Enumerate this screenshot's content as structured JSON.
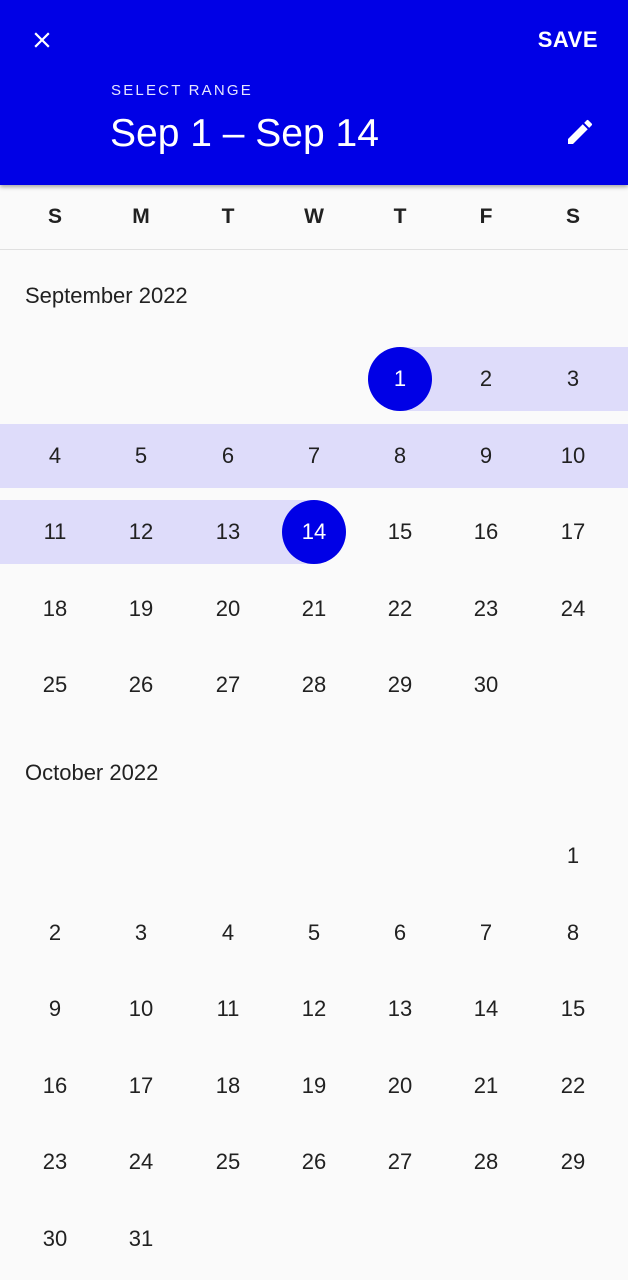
{
  "header": {
    "save_label": "SAVE",
    "select_range_label": "SELECT RANGE",
    "range_title": "Sep 1 – Sep 14",
    "accent_color": "#0000e6",
    "close_icon": "close-icon",
    "edit_icon": "pencil-icon"
  },
  "weekdays": [
    "S",
    "M",
    "T",
    "W",
    "T",
    "F",
    "S"
  ],
  "months": [
    {
      "label": "September 2022",
      "rows": [
        [
          "",
          "",
          "",
          "",
          "1",
          "2",
          "3"
        ],
        [
          "4",
          "5",
          "6",
          "7",
          "8",
          "9",
          "10"
        ],
        [
          "11",
          "12",
          "13",
          "14",
          "15",
          "16",
          "17"
        ],
        [
          "18",
          "19",
          "20",
          "21",
          "22",
          "23",
          "24"
        ],
        [
          "25",
          "26",
          "27",
          "28",
          "29",
          "30",
          ""
        ]
      ],
      "range_start_day": "1",
      "range_end_day": "14"
    },
    {
      "label": "October 2022",
      "rows": [
        [
          "",
          "",
          "",
          "",
          "",
          "",
          "1"
        ],
        [
          "2",
          "3",
          "4",
          "5",
          "6",
          "7",
          "8"
        ],
        [
          "9",
          "10",
          "11",
          "12",
          "13",
          "14",
          "15"
        ],
        [
          "16",
          "17",
          "18",
          "19",
          "20",
          "21",
          "22"
        ],
        [
          "23",
          "24",
          "25",
          "26",
          "27",
          "28",
          "29"
        ],
        [
          "30",
          "31",
          "",
          "",
          "",
          "",
          ""
        ]
      ]
    }
  ]
}
